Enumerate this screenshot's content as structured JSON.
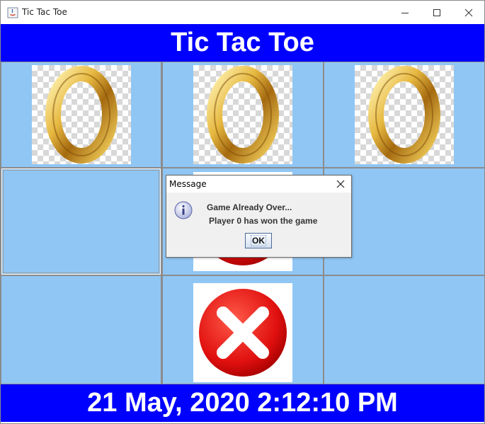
{
  "window": {
    "title": "Tic Tac Toe"
  },
  "header": {
    "title": "Tic Tac Toe"
  },
  "board": {
    "cells": [
      {
        "mark": "O",
        "glyph": "0"
      },
      {
        "mark": "O",
        "glyph": "0"
      },
      {
        "mark": "O",
        "glyph": "0"
      },
      {
        "mark": ""
      },
      {
        "mark": "X"
      },
      {
        "mark": ""
      },
      {
        "mark": ""
      },
      {
        "mark": "X"
      },
      {
        "mark": ""
      }
    ]
  },
  "footer": {
    "datetime": "21 May, 2020 2:12:10 PM"
  },
  "dialog": {
    "title": "Message",
    "line1": "Game Already Over...",
    "line2": "Player 0 has won the game",
    "ok_label": "OK",
    "icon": "info-icon"
  },
  "colors": {
    "banner": "#0000ff",
    "cell": "#90c6f4",
    "x_red": "#e8161a",
    "gold": "#d9a42a"
  }
}
